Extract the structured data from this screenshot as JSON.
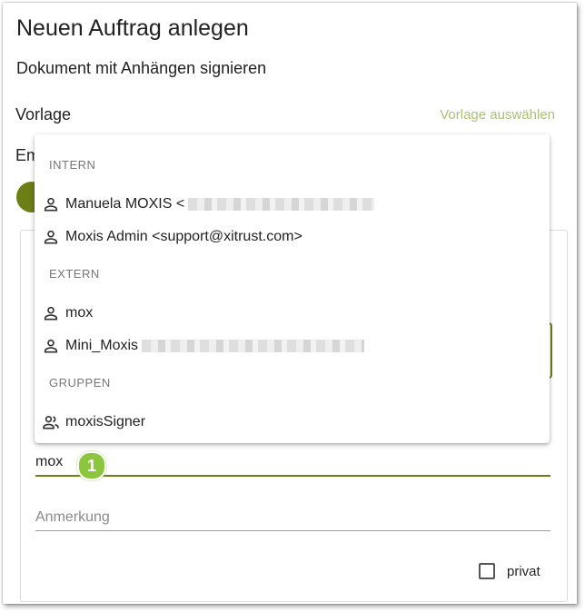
{
  "dialog": {
    "title": "Neuen Auftrag anlegen",
    "subtitle": "Dokument mit Anhängen signieren",
    "vorlage_label": "Vorlage",
    "vorlage_link": "Vorlage auswählen",
    "empfaenger_label_partial": "Em"
  },
  "dropdown": {
    "groups": [
      {
        "header": "INTERN",
        "options": [
          {
            "label": "Manuela MOXIS <",
            "icon": "person-icon",
            "redacted": true
          },
          {
            "label": "Moxis Admin <support@xitrust.com>",
            "icon": "person-icon",
            "redacted": false
          }
        ]
      },
      {
        "header": "EXTERN",
        "options": [
          {
            "label": "mox",
            "icon": "person-icon",
            "redacted": false
          },
          {
            "label": "Mini_Moxis",
            "icon": "person-icon",
            "redacted": true
          }
        ]
      },
      {
        "header": "GRUPPEN",
        "options": [
          {
            "label": "moxisSigner",
            "icon": "group-icon",
            "redacted": false
          }
        ]
      }
    ]
  },
  "search": {
    "value": "mox"
  },
  "badge": {
    "number": "1",
    "color": "#8cc63f"
  },
  "anmerkung": {
    "placeholder": "Anmerkung"
  },
  "privat": {
    "label": "privat",
    "checked": false
  },
  "colors": {
    "accent": "#6b7f16",
    "link": "#a9bf7a"
  }
}
